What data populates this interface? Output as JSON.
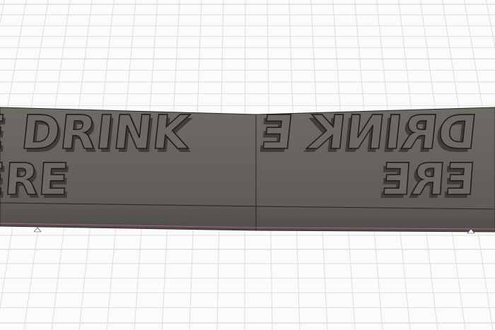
{
  "viewport": {
    "title": "",
    "colors": {
      "background": "#fbfbfb",
      "grid_line": "#dedede",
      "grid_line_major": "#cfcfcf",
      "model_top": "#66635f",
      "model_front": "#5a5753",
      "model_edge": "#2a2826",
      "letter_face": "#6c6965",
      "letter_side": "#4e4b48",
      "edge_highlight": "#c86a7a"
    }
  },
  "model": {
    "left_plate": {
      "line1": "E DRINK",
      "line2": "ERE"
    },
    "right_plate": {
      "line1": "DRINK E",
      "line2": "ERE"
    }
  }
}
